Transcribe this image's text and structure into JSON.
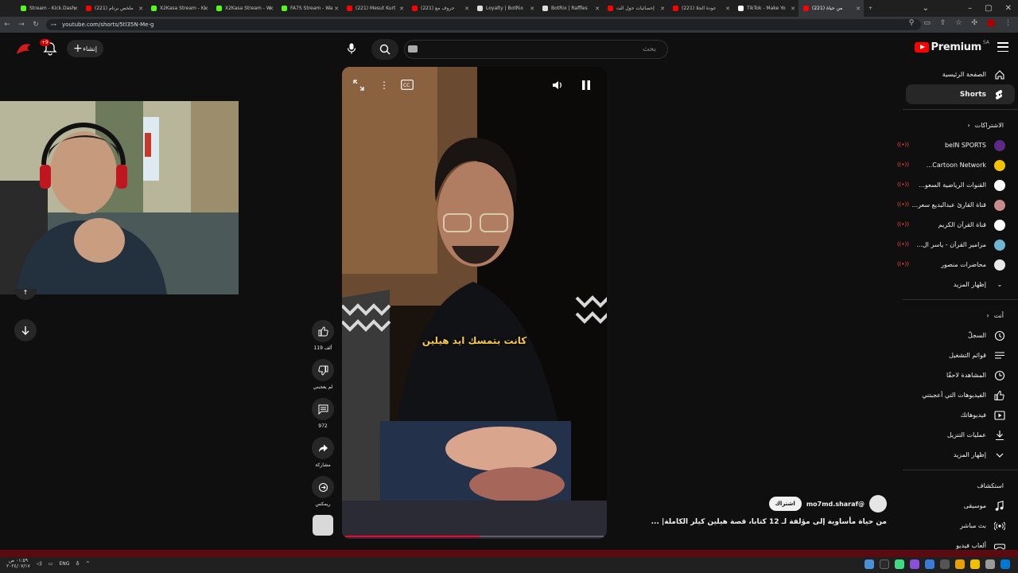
{
  "browser": {
    "tabs": [
      {
        "title": "Stream - Kick.Dash",
        "color": "#53fc18"
      },
      {
        "title": "(221) ملخص برنام",
        "color": "#ff0000"
      },
      {
        "title": "X2Kasa Stream - Ki",
        "color": "#53fc18"
      },
      {
        "title": "X2Kasa Stream - W",
        "color": "#53fc18"
      },
      {
        "title": "FA7S Stream - Wa",
        "color": "#53fc18"
      },
      {
        "title": "(221) Mesut Kurt",
        "color": "#ff0000"
      },
      {
        "title": "(221) حروف مع",
        "color": "#ff0000"
      },
      {
        "title": "Loyalty | BotRix",
        "color": "#dddddd"
      },
      {
        "title": "BotRix | Raffles",
        "color": "#dddddd"
      },
      {
        "title": "إحصائيات حول الت",
        "color": "#ff0000"
      },
      {
        "title": "(221) عودة الجلا",
        "color": "#ff0000"
      },
      {
        "title": "TikTok - Make Yo",
        "color": "#ffffff"
      },
      {
        "title": "(221) من حياة",
        "color": "#ff0000",
        "active": true
      }
    ],
    "url": "youtube.com/shorts/5tl35N-Me-g"
  },
  "header": {
    "logo_text": "Premium",
    "country": "SA",
    "search_placeholder": "بحث",
    "create_label": "إنشاء",
    "notif_count": "+9"
  },
  "sidebar": {
    "main": [
      {
        "label": "الصفحة الرئيسية",
        "icon": "home-icon"
      },
      {
        "label": "Shorts",
        "icon": "shorts-icon",
        "active": true
      }
    ],
    "subs_header": "الاشتراكات",
    "subs": [
      {
        "label": "beIN SPORTS",
        "color": "#5b2a86"
      },
      {
        "label": "Cartoon Network...",
        "color": "#f2c200"
      },
      {
        "label": "القنوات الرياضية السعو...",
        "color": "#ffffff"
      },
      {
        "label": "قناة القارئ عبدالبديع سعر...",
        "color": "#c98b8b"
      },
      {
        "label": "قناة القرآن الكريم",
        "color": "#ffffff"
      },
      {
        "label": "مزامير القرآن - ياسر ال...",
        "color": "#6fb5d4"
      },
      {
        "label": "محاضرات منصور",
        "color": "#e9e9e9"
      }
    ],
    "show_more": "إظهار المزيد",
    "you_header": "أنت",
    "you": [
      {
        "label": "السجلّ",
        "icon": "history-icon"
      },
      {
        "label": "قوائم التشغيل",
        "icon": "playlists-icon"
      },
      {
        "label": "المشاهدة لاحقًا",
        "icon": "watch-later-icon"
      },
      {
        "label": "الفيديوهات التي أعجبتني",
        "icon": "liked-icon"
      },
      {
        "label": "فيديوهاتك",
        "icon": "your-videos-icon"
      },
      {
        "label": "عمليات التنزيل",
        "icon": "download-icon"
      },
      {
        "label": "إظهار المزيد",
        "icon": "chevron-down-icon"
      }
    ],
    "explore_header": "استكشاف",
    "explore": [
      {
        "label": "موسيقى",
        "icon": "music-icon"
      },
      {
        "label": "بث مباشر",
        "icon": "live-icon"
      },
      {
        "label": "ألعاب فيديو",
        "icon": "gaming-icon"
      }
    ]
  },
  "short": {
    "caption": "كانت بتمسك ايد هيلين",
    "progress": 0.52,
    "likes": "119 ألف",
    "dislike_label": "لم يعجبني",
    "comments": "972",
    "share_label": "مشاركة",
    "remix_label": "ريمكس",
    "channel_handle": "@mo7md.sharaf",
    "subscribe_label": "اشتراك",
    "title": "من حياة مأساوية إلى مؤلفة لـ 12 كتابا، قصة هيلين كيلر الكاملة| ..."
  },
  "taskbar": {
    "time": "٠١:٥٩ ص",
    "date": "٢٠٢٤/٠٧/١٧",
    "lang": "ENG"
  }
}
